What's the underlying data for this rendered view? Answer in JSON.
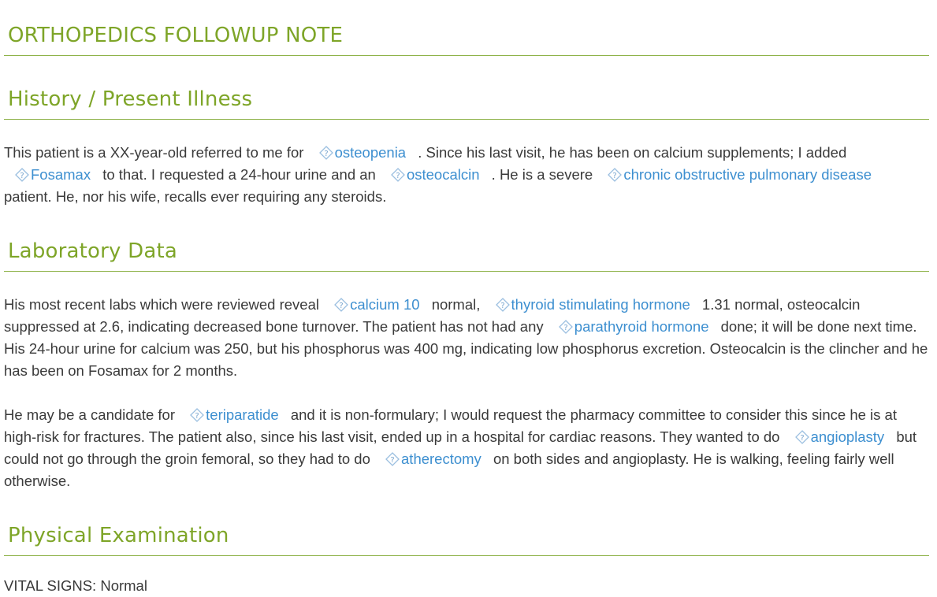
{
  "title": "ORTHOPEDICS FOLLOWUP NOTE",
  "sections": {
    "history": {
      "heading": "History / Present Illness",
      "p1": [
        "This patient is a XX-year-old referred to me for",
        "osteopenia",
        ". Since his last visit, he has been on calcium supplements; I added",
        "Fosamax",
        "to that. I requested a 24-hour urine and an",
        "osteocalcin",
        ". He is a severe",
        "chronic obstructive pulmonary disease",
        "patient. He, nor his wife, recalls ever requiring any steroids."
      ]
    },
    "labs": {
      "heading": "Laboratory Data",
      "p1": [
        "His most recent labs which were reviewed reveal",
        "calcium 10",
        "normal,",
        "thyroid stimulating hormone",
        "1.31 normal, osteocalcin suppressed at 2.6, indicating decreased bone turnover. The patient has not had any",
        "parathyroid hormone",
        "done; it will be done next time. His 24-hour urine for calcium was 250, but his phosphorus was 400 mg, indicating low phosphorus excretion. Osteocalcin is the clincher and he has been on Fosamax for 2 months."
      ],
      "p2": [
        "He may be a candidate for",
        "teriparatide",
        "and it is non-formulary; I would request the pharmacy committee to consider this since he is at high-risk for fractures. The patient also, since his last visit, ended up in a hospital for cardiac reasons. They wanted to do",
        "angioplasty",
        "but could not go through the groin femoral, so they had to do",
        "atherectomy",
        "on both sides and angioplasty. He is walking, feeling fairly well otherwise."
      ]
    },
    "exam": {
      "heading": "Physical Examination",
      "vitals": "VITAL SIGNS: Normal"
    }
  },
  "colors": {
    "heading": "#7ea528",
    "rule": "#8fb34a",
    "term": "#3d8fd0",
    "text": "#3a3a3a"
  },
  "icon": "question-diamond-icon"
}
